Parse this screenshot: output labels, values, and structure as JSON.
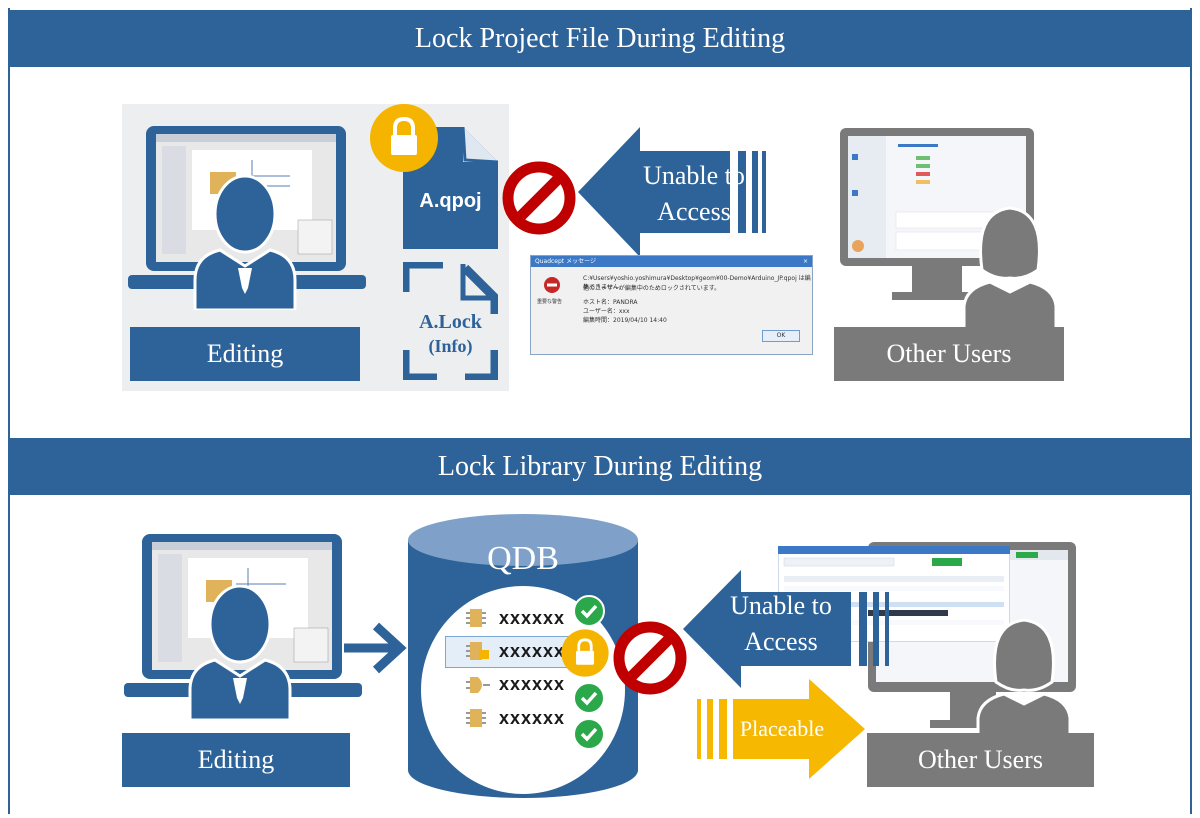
{
  "section1": {
    "title": "Lock Project File During Editing",
    "editing_label": "Editing",
    "project_file": "A.qpoj",
    "lock_file_line1": "A.Lock",
    "lock_file_line2": "(Info)",
    "arrow_text": "Unable to\nAccess",
    "other_users_label": "Other Users",
    "dialog": {
      "title": "Quadcept メッセージ",
      "close": "×",
      "line1": "C:¥Users¥yoshio.yoshimura¥Desktop¥geom¥00-Demo¥Arduino_JP.qpoj は編集できません。",
      "line2": "他のユーザーが編集中のためロックされています。",
      "host": "ホスト名：PANDRA",
      "user": "ユーザー名：xxx",
      "time": "編集時間：2019/04/10 14:40",
      "ok": "OK",
      "error_caption": "重要な警告"
    }
  },
  "section2": {
    "title": "Lock Library During Editing",
    "editing_label": "Editing",
    "qdb_title": "QDB",
    "items": [
      "xxxxxx",
      "xxxxxx",
      "xxxxxx",
      "xxxxxx"
    ],
    "arrow_text": "Unable to\nAccess",
    "placeable": "Placeable",
    "other_users_label": "Other Users"
  },
  "colors": {
    "blue": "#2d6399",
    "gray": "#7a7a7a",
    "lock_yellow": "#f5b400",
    "prohibit_red": "#c00000",
    "check_green": "#2aa84a",
    "placeable_yellow": "#f6b800"
  },
  "icons": [
    "laptop-icon",
    "user-icon",
    "lock-icon",
    "prohibit-icon",
    "monitor-icon",
    "check-icon",
    "chip-icon",
    "arrow-icon",
    "database-icon"
  ]
}
